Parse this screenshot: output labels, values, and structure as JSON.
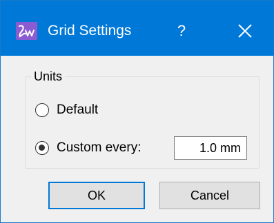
{
  "window": {
    "title": "Grid Settings",
    "help_label": "?",
    "app_icon": "app-logo-icon",
    "close_icon": "close-icon"
  },
  "units_group": {
    "title": "Units",
    "options": [
      {
        "label": "Default",
        "checked": false
      },
      {
        "label": "Custom every:",
        "checked": true
      }
    ],
    "custom_value": "1.0 mm"
  },
  "buttons": {
    "ok": "OK",
    "cancel": "Cancel"
  },
  "colors": {
    "titlebar": "#0078d7",
    "dialog_bg": "#f0f0f0",
    "default_button_border": "#0078d7",
    "app_icon_bg": "#8a5bd1"
  }
}
